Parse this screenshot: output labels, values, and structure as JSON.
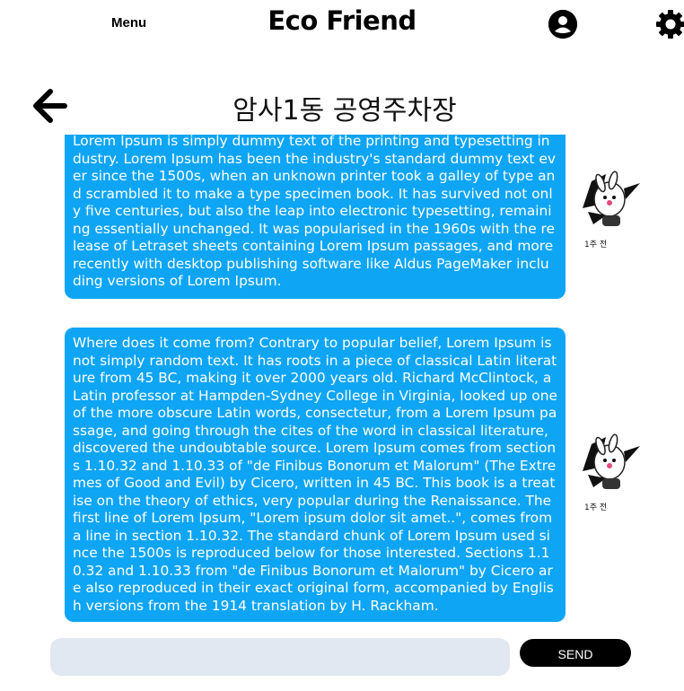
{
  "header": {
    "menu_label": "Menu",
    "app_title": "Eco Friend",
    "profile_icon": "user-circle-icon",
    "settings_icon": "gear-icon"
  },
  "chat": {
    "back_icon": "arrow-left-icon",
    "room_title": "암사1동 공영주차장",
    "messages": [
      {
        "text": "Lorem Ipsum is simply dummy text of the printing and typesetting industry. Lorem Ipsum has been the industry's standard dummy text ever since the 1500s, when an unknown printer took a galley of type and scrambled it to make a type specimen book. It has survived not only five centuries, but also the leap into electronic typesetting, remaining essentially unchanged. It was popularised in the 1960s with the release of Letraset sheets containing Lorem Ipsum passages, and more recently with desktop publishing software like Aldus PageMaker including versions of Lorem Ipsum.",
        "time": "1주 전",
        "avatar": "cartoon-character-avatar"
      },
      {
        "text": "Where does it come from? Contrary to popular belief, Lorem Ipsum is not simply random text. It has roots in a piece of classical Latin literature from 45 BC, making it over 2000 years old. Richard McClintock, a Latin professor at Hampden-Sydney College in Virginia, looked up one of the more obscure Latin words, consectetur, from a Lorem Ipsum passage, and going through the cites of the word in classical literature, discovered the undoubtable source. Lorem Ipsum comes from sections 1.10.32 and 1.10.33 of \"de Finibus Bonorum et Malorum\" (The Extremes of Good and Evil) by Cicero, written in 45 BC. This book is a treatise on the theory of ethics, very popular during the Renaissance. The first line of Lorem Ipsum, \"Lorem ipsum dolor sit amet..\", comes from a line in section 1.10.32. The standard chunk of Lorem Ipsum used since the 1500s is reproduced below for those interested. Sections 1.10.32 and 1.10.33 from \"de Finibus Bonorum et Malorum\" by Cicero are also reproduced in their exact original form, accompanied by English versions from the 1914 translation by H. Rackham.",
        "time": "1주 전",
        "avatar": "cartoon-character-avatar"
      }
    ]
  },
  "composer": {
    "input_value": "",
    "input_placeholder": "",
    "send_label": "SEND"
  },
  "colors": {
    "bubble": "#0ea5f5",
    "input_bg": "#e2e8f2",
    "send_bg": "#000000"
  }
}
